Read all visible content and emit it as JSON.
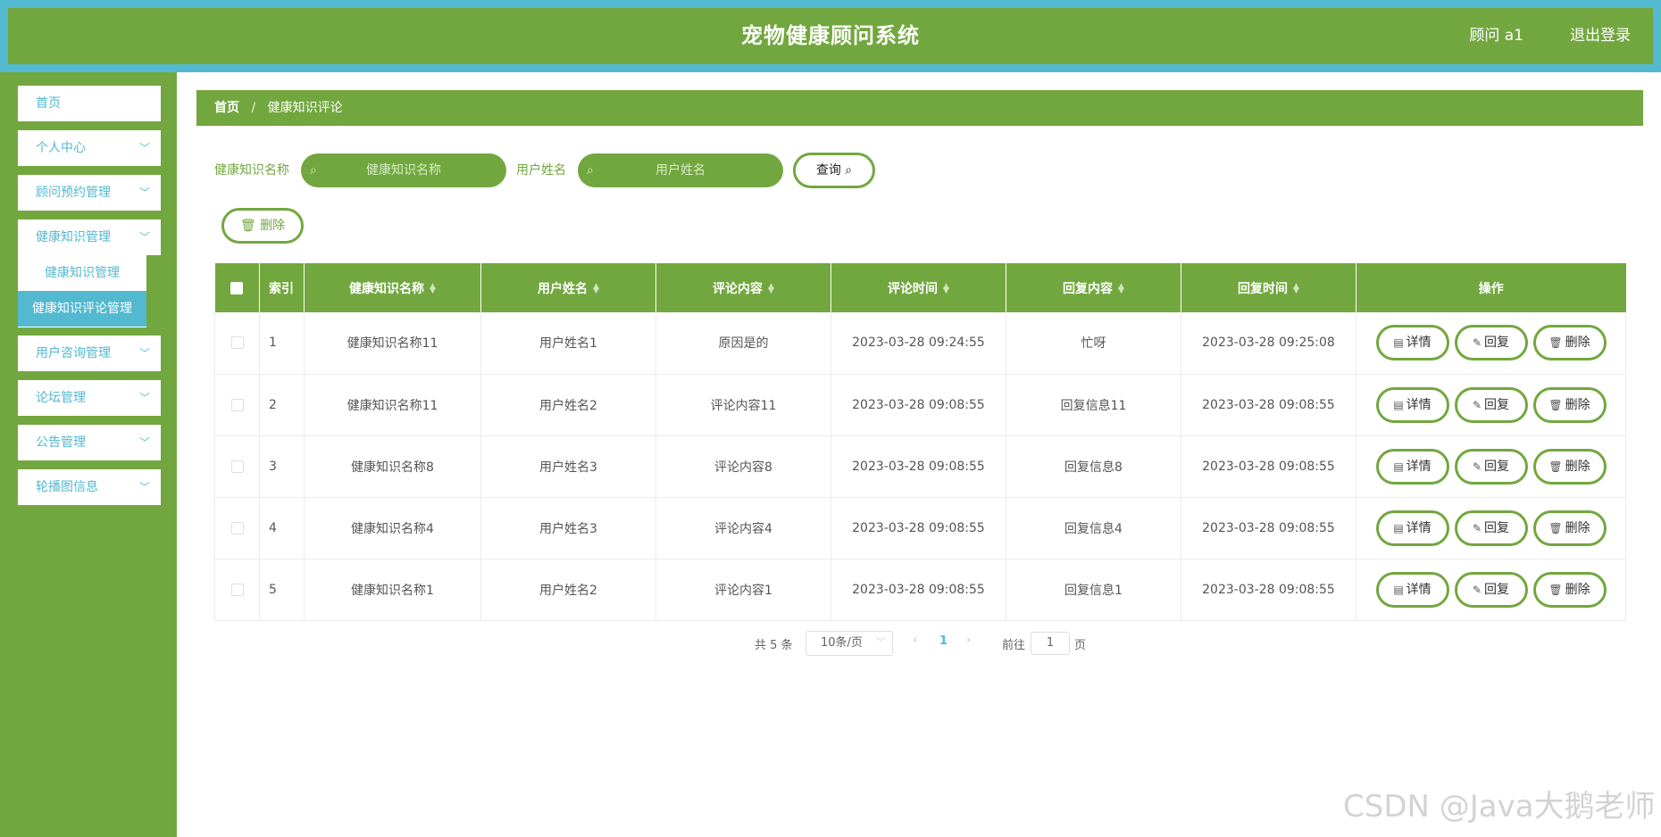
{
  "header": {
    "title": "宠物健康顾问系统",
    "user": "顾问 a1",
    "logout": "退出登录"
  },
  "sidebar": {
    "items": [
      {
        "label": "首页",
        "has_chevron": false
      },
      {
        "label": "个人中心",
        "has_chevron": true
      },
      {
        "label": "顾问预约管理",
        "has_chevron": true
      },
      {
        "label": "健康知识管理",
        "has_chevron": true
      },
      {
        "label": "用户咨询管理",
        "has_chevron": true
      },
      {
        "label": "论坛管理",
        "has_chevron": true
      },
      {
        "label": "公告管理",
        "has_chevron": true
      },
      {
        "label": "轮播图信息",
        "has_chevron": true
      }
    ],
    "subitems": [
      {
        "label": "健康知识管理",
        "active": false
      },
      {
        "label": "健康知识评论管理",
        "active": true
      }
    ]
  },
  "breadcrumb": {
    "home": "首页",
    "separator": "/",
    "current": "健康知识评论"
  },
  "search": {
    "field1_label": "健康知识名称",
    "field1_placeholder": "健康知识名称",
    "field2_label": "用户姓名",
    "field2_placeholder": "用户姓名",
    "query_button": "查询"
  },
  "toolbar": {
    "delete_button": "删除"
  },
  "table": {
    "columns": [
      "索引",
      "健康知识名称",
      "用户姓名",
      "评论内容",
      "评论时间",
      "回复内容",
      "回复时间",
      "操作"
    ],
    "rows": [
      {
        "index": "1",
        "name": "健康知识名称11",
        "user": "用户姓名1",
        "comment": "原因是的",
        "comment_time": "2023-03-28 09:24:55",
        "reply": "忙呀",
        "reply_time": "2023-03-28 09:25:08"
      },
      {
        "index": "2",
        "name": "健康知识名称11",
        "user": "用户姓名2",
        "comment": "评论内容11",
        "comment_time": "2023-03-28 09:08:55",
        "reply": "回复信息11",
        "reply_time": "2023-03-28 09:08:55"
      },
      {
        "index": "3",
        "name": "健康知识名称8",
        "user": "用户姓名3",
        "comment": "评论内容8",
        "comment_time": "2023-03-28 09:08:55",
        "reply": "回复信息8",
        "reply_time": "2023-03-28 09:08:55"
      },
      {
        "index": "4",
        "name": "健康知识名称4",
        "user": "用户姓名3",
        "comment": "评论内容4",
        "comment_time": "2023-03-28 09:08:55",
        "reply": "回复信息4",
        "reply_time": "2023-03-28 09:08:55"
      },
      {
        "index": "5",
        "name": "健康知识名称1",
        "user": "用户姓名2",
        "comment": "评论内容1",
        "comment_time": "2023-03-28 09:08:55",
        "reply": "回复信息1",
        "reply_time": "2023-03-28 09:08:55"
      }
    ],
    "actions": {
      "detail": "详情",
      "reply": "回复",
      "delete": "删除"
    }
  },
  "pagination": {
    "total": "共 5 条",
    "page_size": "10条/页",
    "current_page": "1",
    "goto_label": "前往",
    "goto_value": "1",
    "goto_unit": "页"
  },
  "watermark": "CSDN @Java大鹅老师",
  "colors": {
    "primary_green": "#72a73f",
    "accent_cyan": "#52b9d0"
  }
}
